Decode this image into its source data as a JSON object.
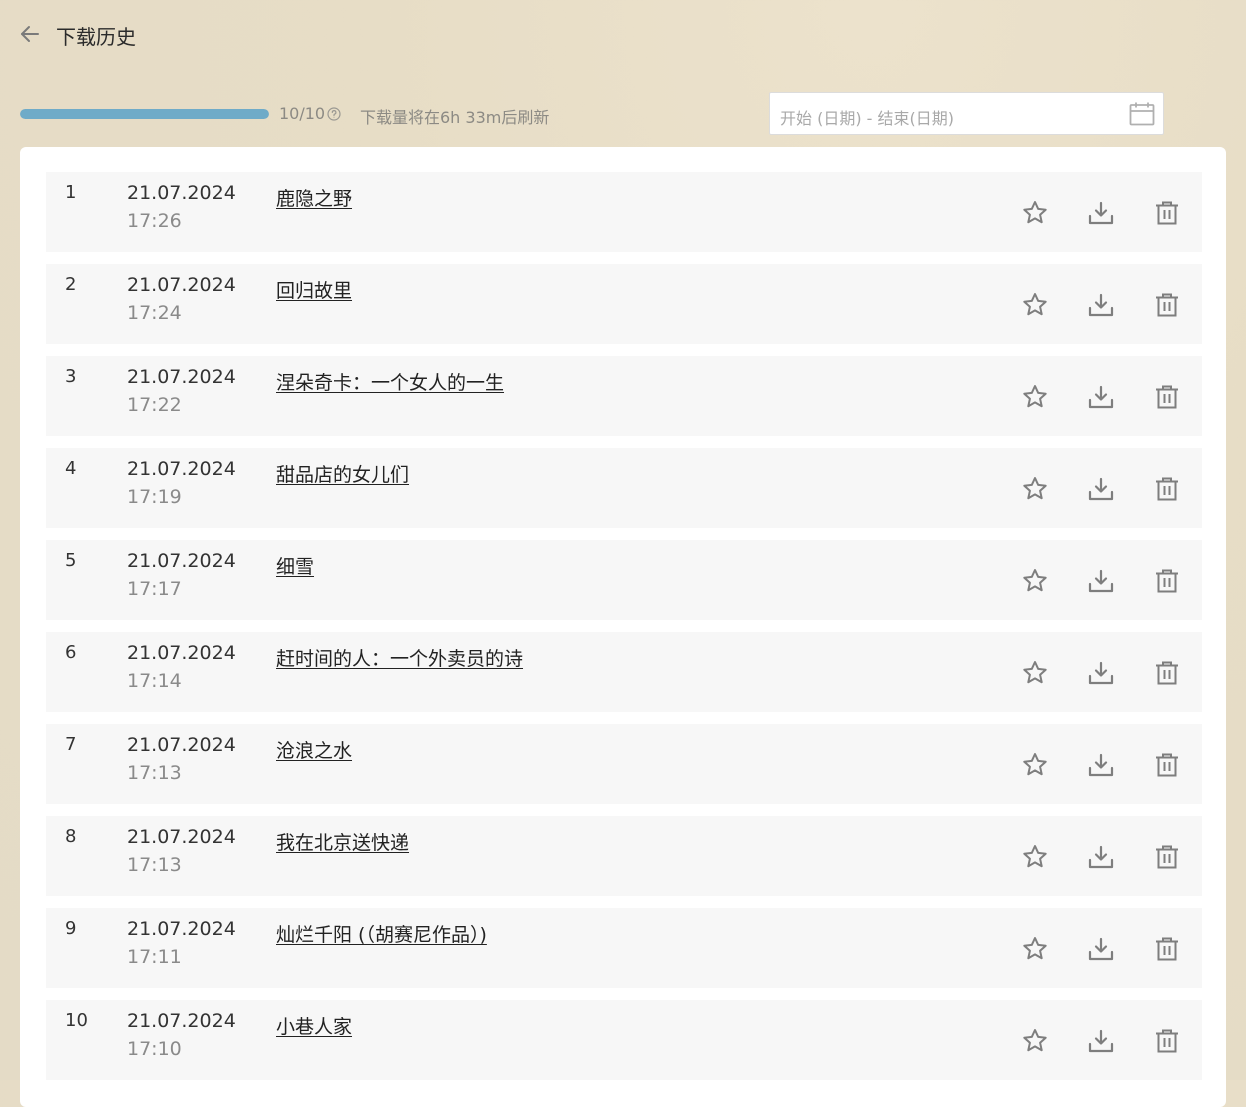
{
  "header": {
    "title": "下载历史"
  },
  "quota": {
    "used": 10,
    "total": 10,
    "text": "10/10",
    "refresh_text": "下载量将在6h 33m后刷新",
    "fill_fraction": 1.0
  },
  "date_range": {
    "placeholder": "开始 (日期) - 结束(日期)"
  },
  "history": [
    {
      "index": "1",
      "date": "21.07.2024",
      "time": "17:26",
      "title": "鹿隐之野"
    },
    {
      "index": "2",
      "date": "21.07.2024",
      "time": "17:24",
      "title": "回归故里"
    },
    {
      "index": "3",
      "date": "21.07.2024",
      "time": "17:22",
      "title": "涅朵奇卡：一个女人的一生"
    },
    {
      "index": "4",
      "date": "21.07.2024",
      "time": "17:19",
      "title": "甜品店的女儿们"
    },
    {
      "index": "5",
      "date": "21.07.2024",
      "time": "17:17",
      "title": "细雪"
    },
    {
      "index": "6",
      "date": "21.07.2024",
      "time": "17:14",
      "title": "赶时间的人：一个外卖员的诗"
    },
    {
      "index": "7",
      "date": "21.07.2024",
      "time": "17:13",
      "title": "沧浪之水"
    },
    {
      "index": "8",
      "date": "21.07.2024",
      "time": "17:13",
      "title": "我在北京送快递"
    },
    {
      "index": "9",
      "date": "21.07.2024",
      "time": "17:11",
      "title": "灿烂千阳 (（胡赛尼作品）)"
    },
    {
      "index": "10",
      "date": "21.07.2024",
      "time": "17:10",
      "title": "小巷人家"
    }
  ],
  "icons": {
    "back": "arrow-left-icon",
    "help": "question-circle-icon",
    "calendar": "calendar-icon",
    "favorite": "star-icon",
    "download": "download-icon",
    "delete": "trash-icon"
  },
  "colors": {
    "progress": "#6fabc8",
    "background": "#e7ddc6"
  }
}
